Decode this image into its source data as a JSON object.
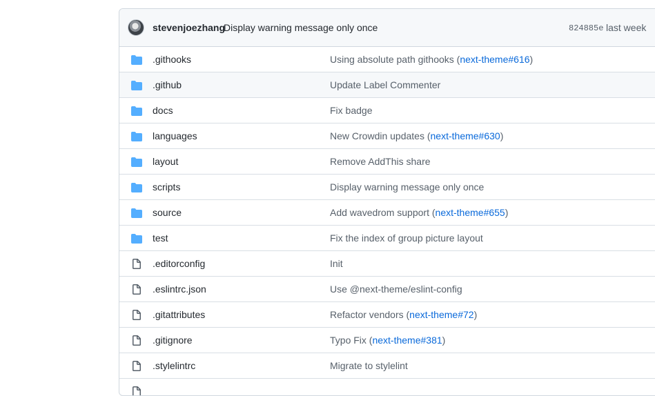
{
  "latest_commit": {
    "author": "stevenjoezhang",
    "message": "Display warning message only once",
    "sha": "824885e",
    "time": "last week"
  },
  "icons": {
    "dir": "folder-icon",
    "file": "file-icon",
    "dir_color": "#54aeff",
    "file_color": "#57606a"
  },
  "entries": [
    {
      "type": "dir",
      "name": ".githooks",
      "msg_pre": "Using absolute path githooks (",
      "link": "next-theme#616",
      "msg_post": ")"
    },
    {
      "type": "dir",
      "name": ".github",
      "msg_pre": "Update Label Commenter",
      "link": "",
      "msg_post": ""
    },
    {
      "type": "dir",
      "name": "docs",
      "msg_pre": "Fix badge",
      "link": "",
      "msg_post": ""
    },
    {
      "type": "dir",
      "name": "languages",
      "msg_pre": "New Crowdin updates (",
      "link": "next-theme#630",
      "msg_post": ")"
    },
    {
      "type": "dir",
      "name": "layout",
      "msg_pre": "Remove AddThis share",
      "link": "",
      "msg_post": ""
    },
    {
      "type": "dir",
      "name": "scripts",
      "msg_pre": "Display warning message only once",
      "link": "",
      "msg_post": ""
    },
    {
      "type": "dir",
      "name": "source",
      "msg_pre": "Add wavedrom support (",
      "link": "next-theme#655",
      "msg_post": ")"
    },
    {
      "type": "dir",
      "name": "test",
      "msg_pre": "Fix the index of group picture layout",
      "link": "",
      "msg_post": ""
    },
    {
      "type": "file",
      "name": ".editorconfig",
      "msg_pre": "Init",
      "link": "",
      "msg_post": ""
    },
    {
      "type": "file",
      "name": ".eslintrc.json",
      "msg_pre": "Use @next-theme/eslint-config",
      "link": "",
      "msg_post": ""
    },
    {
      "type": "file",
      "name": ".gitattributes",
      "msg_pre": "Refactor vendors (",
      "link": "next-theme#72",
      "msg_post": ")"
    },
    {
      "type": "file",
      "name": ".gitignore",
      "msg_pre": "Typo Fix (",
      "link": "next-theme#381",
      "msg_post": ")"
    },
    {
      "type": "file",
      "name": ".stylelintrc",
      "msg_pre": "Migrate to stylelint",
      "link": "",
      "msg_post": ""
    },
    {
      "type": "file",
      "name": "",
      "msg_pre": "",
      "link": "",
      "msg_post": ""
    }
  ]
}
